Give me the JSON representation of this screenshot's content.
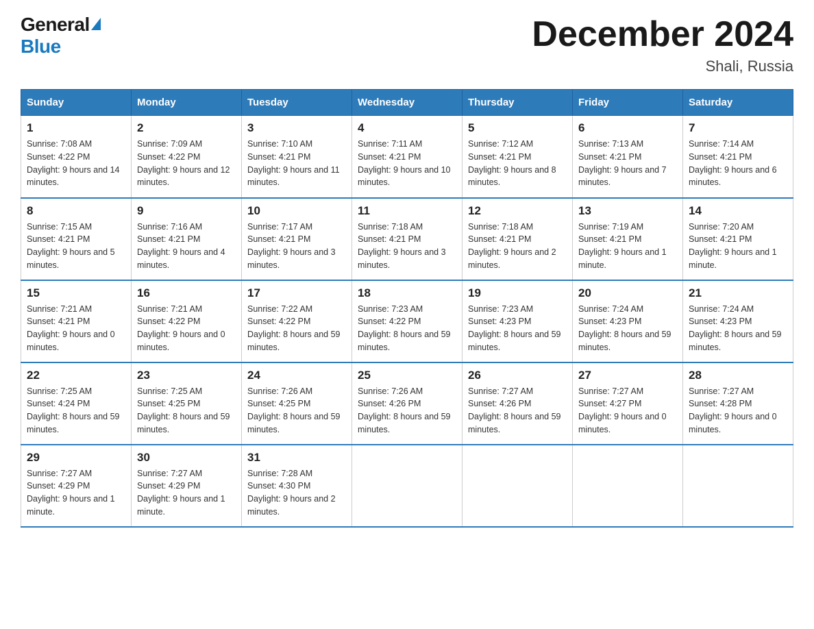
{
  "logo": {
    "general": "General",
    "blue": "Blue"
  },
  "title": "December 2024",
  "subtitle": "Shali, Russia",
  "days_of_week": [
    "Sunday",
    "Monday",
    "Tuesday",
    "Wednesday",
    "Thursday",
    "Friday",
    "Saturday"
  ],
  "weeks": [
    [
      {
        "day": "1",
        "sunrise": "7:08 AM",
        "sunset": "4:22 PM",
        "daylight": "9 hours and 14 minutes."
      },
      {
        "day": "2",
        "sunrise": "7:09 AM",
        "sunset": "4:22 PM",
        "daylight": "9 hours and 12 minutes."
      },
      {
        "day": "3",
        "sunrise": "7:10 AM",
        "sunset": "4:21 PM",
        "daylight": "9 hours and 11 minutes."
      },
      {
        "day": "4",
        "sunrise": "7:11 AM",
        "sunset": "4:21 PM",
        "daylight": "9 hours and 10 minutes."
      },
      {
        "day": "5",
        "sunrise": "7:12 AM",
        "sunset": "4:21 PM",
        "daylight": "9 hours and 8 minutes."
      },
      {
        "day": "6",
        "sunrise": "7:13 AM",
        "sunset": "4:21 PM",
        "daylight": "9 hours and 7 minutes."
      },
      {
        "day": "7",
        "sunrise": "7:14 AM",
        "sunset": "4:21 PM",
        "daylight": "9 hours and 6 minutes."
      }
    ],
    [
      {
        "day": "8",
        "sunrise": "7:15 AM",
        "sunset": "4:21 PM",
        "daylight": "9 hours and 5 minutes."
      },
      {
        "day": "9",
        "sunrise": "7:16 AM",
        "sunset": "4:21 PM",
        "daylight": "9 hours and 4 minutes."
      },
      {
        "day": "10",
        "sunrise": "7:17 AM",
        "sunset": "4:21 PM",
        "daylight": "9 hours and 3 minutes."
      },
      {
        "day": "11",
        "sunrise": "7:18 AM",
        "sunset": "4:21 PM",
        "daylight": "9 hours and 3 minutes."
      },
      {
        "day": "12",
        "sunrise": "7:18 AM",
        "sunset": "4:21 PM",
        "daylight": "9 hours and 2 minutes."
      },
      {
        "day": "13",
        "sunrise": "7:19 AM",
        "sunset": "4:21 PM",
        "daylight": "9 hours and 1 minute."
      },
      {
        "day": "14",
        "sunrise": "7:20 AM",
        "sunset": "4:21 PM",
        "daylight": "9 hours and 1 minute."
      }
    ],
    [
      {
        "day": "15",
        "sunrise": "7:21 AM",
        "sunset": "4:21 PM",
        "daylight": "9 hours and 0 minutes."
      },
      {
        "day": "16",
        "sunrise": "7:21 AM",
        "sunset": "4:22 PM",
        "daylight": "9 hours and 0 minutes."
      },
      {
        "day": "17",
        "sunrise": "7:22 AM",
        "sunset": "4:22 PM",
        "daylight": "8 hours and 59 minutes."
      },
      {
        "day": "18",
        "sunrise": "7:23 AM",
        "sunset": "4:22 PM",
        "daylight": "8 hours and 59 minutes."
      },
      {
        "day": "19",
        "sunrise": "7:23 AM",
        "sunset": "4:23 PM",
        "daylight": "8 hours and 59 minutes."
      },
      {
        "day": "20",
        "sunrise": "7:24 AM",
        "sunset": "4:23 PM",
        "daylight": "8 hours and 59 minutes."
      },
      {
        "day": "21",
        "sunrise": "7:24 AM",
        "sunset": "4:23 PM",
        "daylight": "8 hours and 59 minutes."
      }
    ],
    [
      {
        "day": "22",
        "sunrise": "7:25 AM",
        "sunset": "4:24 PM",
        "daylight": "8 hours and 59 minutes."
      },
      {
        "day": "23",
        "sunrise": "7:25 AM",
        "sunset": "4:25 PM",
        "daylight": "8 hours and 59 minutes."
      },
      {
        "day": "24",
        "sunrise": "7:26 AM",
        "sunset": "4:25 PM",
        "daylight": "8 hours and 59 minutes."
      },
      {
        "day": "25",
        "sunrise": "7:26 AM",
        "sunset": "4:26 PM",
        "daylight": "8 hours and 59 minutes."
      },
      {
        "day": "26",
        "sunrise": "7:27 AM",
        "sunset": "4:26 PM",
        "daylight": "8 hours and 59 minutes."
      },
      {
        "day": "27",
        "sunrise": "7:27 AM",
        "sunset": "4:27 PM",
        "daylight": "9 hours and 0 minutes."
      },
      {
        "day": "28",
        "sunrise": "7:27 AM",
        "sunset": "4:28 PM",
        "daylight": "9 hours and 0 minutes."
      }
    ],
    [
      {
        "day": "29",
        "sunrise": "7:27 AM",
        "sunset": "4:29 PM",
        "daylight": "9 hours and 1 minute."
      },
      {
        "day": "30",
        "sunrise": "7:27 AM",
        "sunset": "4:29 PM",
        "daylight": "9 hours and 1 minute."
      },
      {
        "day": "31",
        "sunrise": "7:28 AM",
        "sunset": "4:30 PM",
        "daylight": "9 hours and 2 minutes."
      },
      null,
      null,
      null,
      null
    ]
  ]
}
